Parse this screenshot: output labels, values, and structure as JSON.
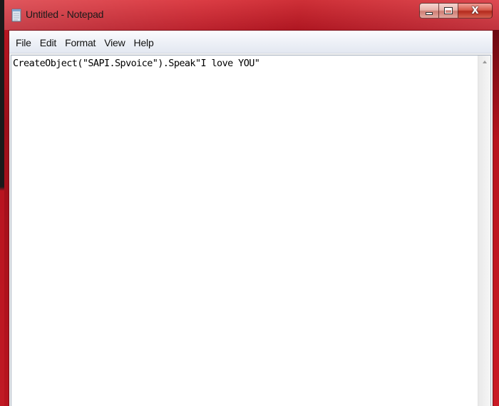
{
  "window": {
    "title": "Untitled - Notepad",
    "accent_color": "#b8141f",
    "icon": "notepad-icon"
  },
  "caption_buttons": {
    "minimize": "minimize-icon",
    "maximize": "maximize-icon",
    "close": "close-icon",
    "close_glyph": "X"
  },
  "menu": {
    "items": [
      "File",
      "Edit",
      "Format",
      "View",
      "Help"
    ]
  },
  "editor": {
    "content": "CreateObject(\"SAPI.Spvoice\").Speak\"I love YOU\""
  },
  "scrollbar": {
    "up_arrow": "scroll-up-arrow-icon"
  }
}
